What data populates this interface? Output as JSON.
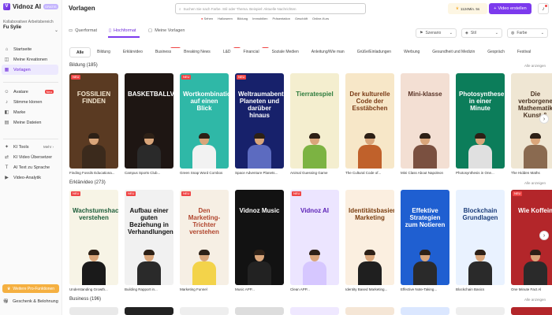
{
  "app": {
    "name": "Vidnoz AI",
    "badge": "GRATIS"
  },
  "workspace": {
    "label": "Kollaborativer Arbeitsbereich",
    "name": "Fu Sylie"
  },
  "nav": [
    {
      "icon": "⌂",
      "label": "Startseite"
    },
    {
      "icon": "◫",
      "label": "Meine Kreationen"
    },
    {
      "icon": "▦",
      "label": "Vorlagen",
      "active": true
    }
  ],
  "nav2": [
    {
      "icon": "☺",
      "label": "Avatare",
      "badge": "Neu"
    },
    {
      "icon": "♪",
      "label": "Stimme klonen"
    },
    {
      "icon": "◧",
      "label": "Marke"
    },
    {
      "icon": "▤",
      "label": "Meine Dateien"
    }
  ],
  "nav3": [
    {
      "icon": "✦",
      "label": "KI Tools",
      "meta": "Mehr ›"
    },
    {
      "icon": "⇄",
      "label": "KI Video Übersetzer"
    },
    {
      "icon": "T",
      "label": "AI Text zu Sprache"
    },
    {
      "icon": "▶",
      "label": "Video-Analytik"
    }
  ],
  "pro_button": "Weitere Pro-Funktionen",
  "gift": "Geschenk & Belohnung",
  "page_title": "Vorlagen",
  "search_placeholder": "Suchen Sie nach Farbe. Stil oder Thema. Beispiel: Aktuelle Nachrichten",
  "search_chips": [
    "Sehen",
    "Halloween",
    "Bildung",
    "Immobilien",
    "Präsentation",
    "Geschäft",
    "Online-Kurs"
  ],
  "minutes": "1124Min. 5s",
  "create_button": "Video erstellen",
  "formats": [
    {
      "label": "Querformat"
    },
    {
      "label": "Hochformat",
      "active": true
    },
    {
      "label": "Meine Vorlagen"
    }
  ],
  "filters": [
    "Szenario",
    "Stil",
    "Farbe"
  ],
  "categories": [
    {
      "label": "Alle",
      "active": true
    },
    {
      "label": "Bildung"
    },
    {
      "label": "Erklärvideo"
    },
    {
      "label": "Business",
      "badge": "Beliebt"
    },
    {
      "label": "Breaking News"
    },
    {
      "label": "L&D",
      "badge": "Neu"
    },
    {
      "label": "Financial",
      "badge": "Neu"
    },
    {
      "label": "Soziale Medien"
    },
    {
      "label": "Anleitung/Wie man"
    },
    {
      "label": "Grüße/Einladungen"
    },
    {
      "label": "Werbung"
    },
    {
      "label": "Gesundheit und Medizin"
    },
    {
      "label": "Gespräch"
    },
    {
      "label": "Festival"
    }
  ],
  "see_all": "Alle anzeigen",
  "sections": [
    {
      "title": "Bildung (185)",
      "cards": [
        {
          "title": "FOSSILIEN FINDEN",
          "caption": "Finding Fossils Educationa...",
          "neu": "NEU",
          "bg": "#5a3a22",
          "fg": "#f3e6cf",
          "body": "#3b2a1c"
        },
        {
          "title": "BASKETBALLVEREIN",
          "caption": "Campus Sports Club...",
          "neu": "",
          "bg": "#1e1613",
          "fg": "#ffffff",
          "body": "#2a2a2a"
        },
        {
          "title": "Wortkombinationen auf einen Blick",
          "caption": "Green Snap Word Combos",
          "neu": "NEU",
          "bg": "#2fb8a7",
          "fg": "#ffffff",
          "body": "#f2f2f2"
        },
        {
          "title": "Weltraumabenteuer: Planeten und darüber hinaus",
          "caption": "Space Adventure Planets...",
          "neu": "NEU",
          "bg": "#17216b",
          "fg": "#ffffff",
          "body": "#5c6bc0"
        },
        {
          "title": "Tierratespiel",
          "caption": "Animal Guessing Game",
          "neu": "",
          "bg": "#f4eecf",
          "fg": "#2b7a3b",
          "body": "#7cb342"
        },
        {
          "title": "Der kulturelle Code der Esstäbchen",
          "caption": "The Cultural Code of...",
          "neu": "",
          "bg": "#f7e7c8",
          "fg": "#7a3b16",
          "body": "#c0612b"
        },
        {
          "title": "Mini-klasse",
          "caption": "Mini Class About Napoleon",
          "neu": "",
          "bg": "#f3dfd3",
          "fg": "#5a3427",
          "body": "#7a5040"
        },
        {
          "title": "Photosynthese in einer Minute",
          "caption": "Photosynthesis in One...",
          "neu": "",
          "bg": "#0c7d5a",
          "fg": "#ffffff",
          "body": "#e0e0e0"
        },
        {
          "title": "Die verborgene Mathematik Kunst &",
          "caption": "The Hidden Maths",
          "neu": "",
          "bg": "#efe6d3",
          "fg": "#4a3322",
          "body": "#8a6a50"
        }
      ]
    },
    {
      "title": "Erklärvideo (273)",
      "cards": [
        {
          "title": "Wachstumshacking verstehen",
          "caption": "Understanding Growth...",
          "neu": "NEU",
          "bg": "#f7f4e6",
          "fg": "#1e5e3a",
          "body": "#1a1a1a"
        },
        {
          "title": "Aufbau einer guten Beziehung in Verhandlungen",
          "caption": "Building Rapport in...",
          "neu": "NEU",
          "bg": "#f1f1f1",
          "fg": "#111111",
          "body": "#2a2a2a"
        },
        {
          "title": "Den Marketing-Trichter verstehen",
          "caption": "Marketing Funnel",
          "neu": "NEU",
          "bg": "#f6efe4",
          "fg": "#b0452d",
          "body": "#f3d34a"
        },
        {
          "title": "Vidnoz Music",
          "caption": "Music APP...",
          "neu": "",
          "bg": "#121212",
          "fg": "#ffffff",
          "body": "#222222"
        },
        {
          "title": "Vidnoz AI",
          "caption": "Clean APP...",
          "neu": "NEU",
          "bg": "#ece5ff",
          "fg": "#5b21b6",
          "body": "#d6c7ff"
        },
        {
          "title": "Identitätsbasiertes Marketing",
          "caption": "Identity Based Marketing...",
          "neu": "",
          "bg": "#fbefe0",
          "fg": "#7a3e10",
          "body": "#1f1f1f"
        },
        {
          "title": "Effektive Strategien zum Notieren",
          "caption": "Effective Note-Taking...",
          "neu": "",
          "bg": "#1f5fd1",
          "fg": "#ffffff",
          "body": "#2a2a2a"
        },
        {
          "title": "Blockchain Grundlagen",
          "caption": "Blockchain Basics",
          "neu": "",
          "bg": "#e9f2ff",
          "fg": "#1b3d7a",
          "body": "#2a2a2a"
        },
        {
          "title": "Wie Koffein",
          "caption": "One Minute Fact Al",
          "neu": "NEU",
          "bg": "#b3262a",
          "fg": "#ffffff",
          "body": "#2a2a2a"
        }
      ]
    },
    {
      "title": "Business (196)",
      "cards": []
    }
  ]
}
